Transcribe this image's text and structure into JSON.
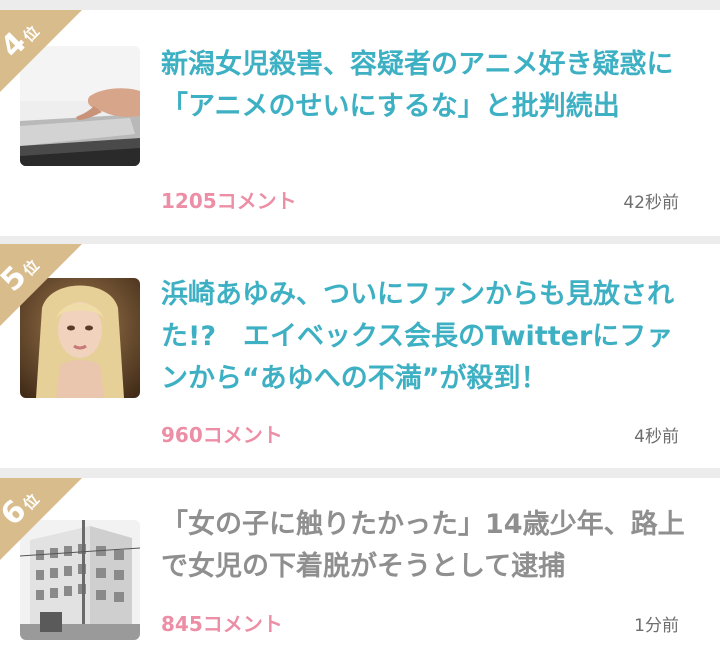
{
  "ranking": {
    "rank_suffix": "位",
    "items": [
      {
        "rank": "4",
        "title": "新潟女児殺害、容疑者のアニメ好き疑惑に「アニメのせいにするな」と批判続出",
        "comments": "1205コメント",
        "time": "42秒前"
      },
      {
        "rank": "5",
        "title": "浜崎あゆみ、ついにファンからも見放された!?　エイベックス会長のTwitterにファンから“あゆへの不満”が殺到！",
        "comments": "960コメント",
        "time": "4秒前"
      },
      {
        "rank": "6",
        "title": "「女の子に触りたかった」14歳少年、路上で女児の下着脱がそうとして逮捕",
        "comments": "845コメント",
        "time": "1分前"
      }
    ]
  },
  "colors": {
    "title_link": "#3eb0c3",
    "title_visited": "#8f8f8f",
    "comments": "#ec8ea5",
    "badge": "#d8bc8b"
  }
}
